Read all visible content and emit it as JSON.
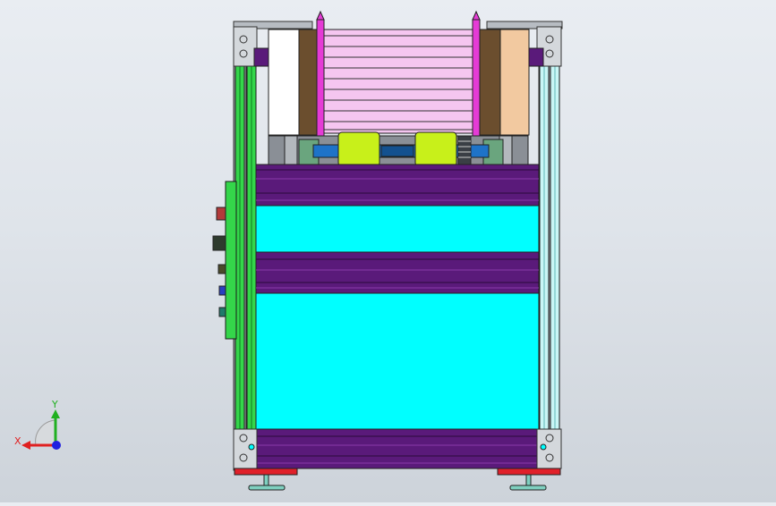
{
  "viewport": {
    "background_top": "#e9edf2",
    "background_bottom": "#cdd3da"
  },
  "triad": {
    "x_label": "X",
    "y_label": "Y",
    "x_color": "#e02020",
    "y_color": "#20b020",
    "z_color": "#2020e0"
  },
  "model": {
    "frame_color": "#8a8f96",
    "green_panel_color": "#34d64a",
    "cyan_panel_color": "#00ffff",
    "purple_rail_color": "#5a1a7a",
    "pink_stack_color": "#f5c6f0",
    "magenta_rod_color": "#e53bd6",
    "brown_block_color": "#6b4e2e",
    "tan_block_color": "#f2c9a0",
    "lime_roller_color": "#c8f01a",
    "blue_shaft_color": "#1e73c8",
    "red_base_color": "#e0202a",
    "light_cyan_post_color": "#c9f6f6"
  }
}
